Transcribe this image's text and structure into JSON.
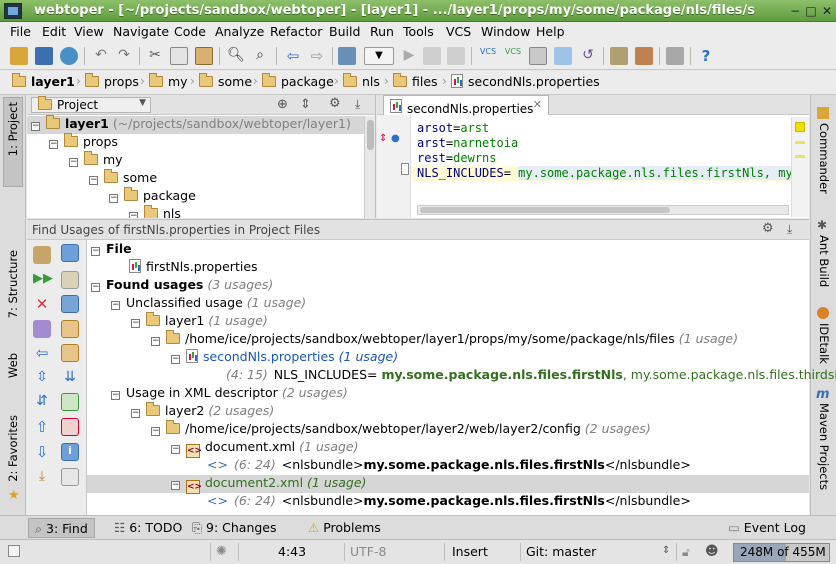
{
  "window": {
    "title": "webtoper - [~/projects/sandbox/webtoper] - [layer1] - .../layer1/props/my/some/package/nls/files/s"
  },
  "menu": [
    "File",
    "Edit",
    "View",
    "Navigate",
    "Code",
    "Analyze",
    "Refactor",
    "Build",
    "Run",
    "Tools",
    "VCS",
    "Window",
    "Help"
  ],
  "breadcrumbs": [
    "layer1",
    "props",
    "my",
    "some",
    "package",
    "nls",
    "files",
    "secondNls.properties"
  ],
  "project_panel": {
    "selector": "Project",
    "tree": [
      {
        "label": "layer1",
        "detail": "(~/projects/sandbox/webtoper/layer1)"
      },
      {
        "label": "props"
      },
      {
        "label": "my"
      },
      {
        "label": "some"
      },
      {
        "label": "package"
      },
      {
        "label": "nls"
      }
    ]
  },
  "editor": {
    "tab": "secondNls.properties",
    "lines": [
      {
        "key": "arsot",
        "value": "arst"
      },
      {
        "key": "arst",
        "value": "narnetoia"
      },
      {
        "key": "rest",
        "value": "dewrns"
      },
      {
        "key": "NLS_INCLUDES",
        "value": "my.some.package.nls.files.firstNls, my."
      }
    ]
  },
  "find_panel": {
    "title": "Find Usages of  firstNls.properties in Project Files",
    "rows": {
      "file_header": "File",
      "file_item": "firstNls.properties",
      "found": "Found usages",
      "found_count": "(3 usages)",
      "unclassified": "Unclassified usage",
      "unclassified_count": "(1 usage)",
      "layer1": "layer1",
      "layer1_count": "(1 usage)",
      "path1": "/home/ice/projects/sandbox/webtoper/layer1/props/my/some/package/nls/files",
      "path1_count": "(1 usage)",
      "second": "secondNls.properties",
      "second_count": "(1 usage)",
      "usage1_loc": "(4: 15)",
      "usage1_pre": "NLS_INCLUDES= ",
      "usage1_match": "my.some.package.nls.files.firstNls",
      "usage1_post": ", my.some.package.nls.files.thirdsNls",
      "xml_desc": "Usage in XML descriptor",
      "xml_desc_count": "(2 usages)",
      "layer2": "layer2",
      "layer2_count": "(2 usages)",
      "path2": "/home/ice/projects/sandbox/webtoper/layer2/web/layer2/config",
      "path2_count": "(2 usages)",
      "doc1": "document.xml",
      "doc1_count": "(1 usage)",
      "doc1_loc": "(6: 24)",
      "doc1_pre": "<nlsbundle>",
      "doc1_match": "my.some.package.nls.files.firstNls",
      "doc1_post": "</nlsbundle>",
      "doc2": "document2.xml",
      "doc2_count": "(1 usage)",
      "doc2_loc": "(6: 24)",
      "doc2_pre": "<nlsbundle>",
      "doc2_match": "my.some.package.nls.files.firstNls",
      "doc2_post": "</nlsbundle>"
    }
  },
  "left_stripe": [
    "1: Project",
    "7: Structure",
    "Web",
    "2: Favorites"
  ],
  "right_stripe": [
    "Commander",
    "Ant Build",
    "IDEtalk",
    "Maven Projects"
  ],
  "bottom_tabs": {
    "find": "3: Find",
    "todo": "6: TODO",
    "changes": "9: Changes",
    "problems": "Problems",
    "event_log": "Event Log"
  },
  "status": {
    "position": "4:43",
    "encoding": "UTF-8",
    "mode": "Insert",
    "vcs": "Git: master",
    "memory": "248M of 455M"
  },
  "colors": {
    "title_bar": "#6aa84f",
    "selection": "#d6d6d6",
    "match": "#33701f",
    "link": "#1a55b8"
  }
}
